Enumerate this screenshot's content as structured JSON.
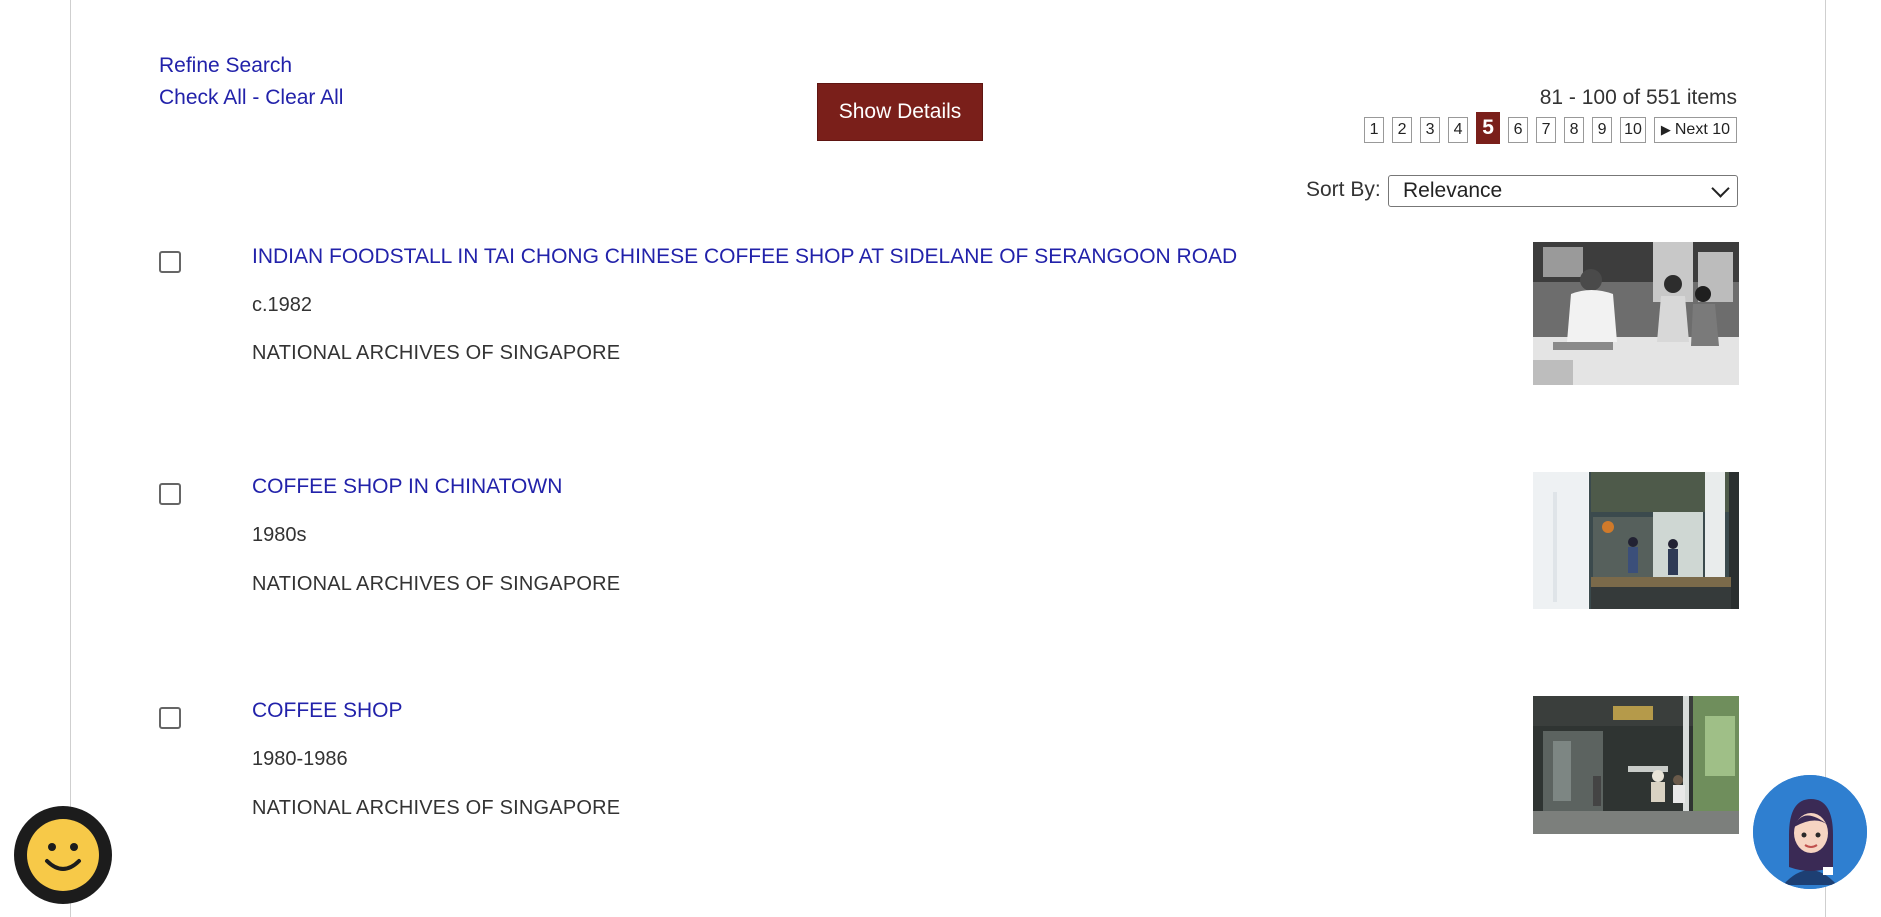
{
  "controls": {
    "refine_search": "Refine Search",
    "check_all": "Check All",
    "separator": "-",
    "clear_all": "Clear All",
    "show_details": "Show Details"
  },
  "pagination": {
    "count_text": "81 - 100 of 551 items",
    "pages": [
      "1",
      "2",
      "3",
      "4",
      "5",
      "6",
      "7",
      "8",
      "9",
      "10"
    ],
    "current_page": "5",
    "next_label": "Next 10",
    "next_icon": "play-triangle-icon"
  },
  "sort": {
    "label": "Sort By:",
    "selected": "Relevance"
  },
  "results": [
    {
      "title": "INDIAN FOODSTALL IN TAI CHONG CHINESE COFFEE SHOP AT SIDELANE OF SERANGOON ROAD",
      "date": "c.1982",
      "source": "NATIONAL ARCHIVES OF SINGAPORE",
      "checked": false
    },
    {
      "title": "COFFEE SHOP IN CHINATOWN",
      "date": "1980s",
      "source": "NATIONAL ARCHIVES OF SINGAPORE",
      "checked": false
    },
    {
      "title": "COFFEE SHOP",
      "date": "1980-1986",
      "source": "NATIONAL ARCHIVES OF SINGAPORE",
      "checked": false
    }
  ],
  "widgets": {
    "feedback_icon": "smiley-face-icon",
    "assistant_icon": "assistant-avatar-icon"
  },
  "colors": {
    "link": "#2222aa",
    "accent": "#7a1f1a",
    "text": "#333333",
    "assistant_bg": "#2f7fd0"
  }
}
